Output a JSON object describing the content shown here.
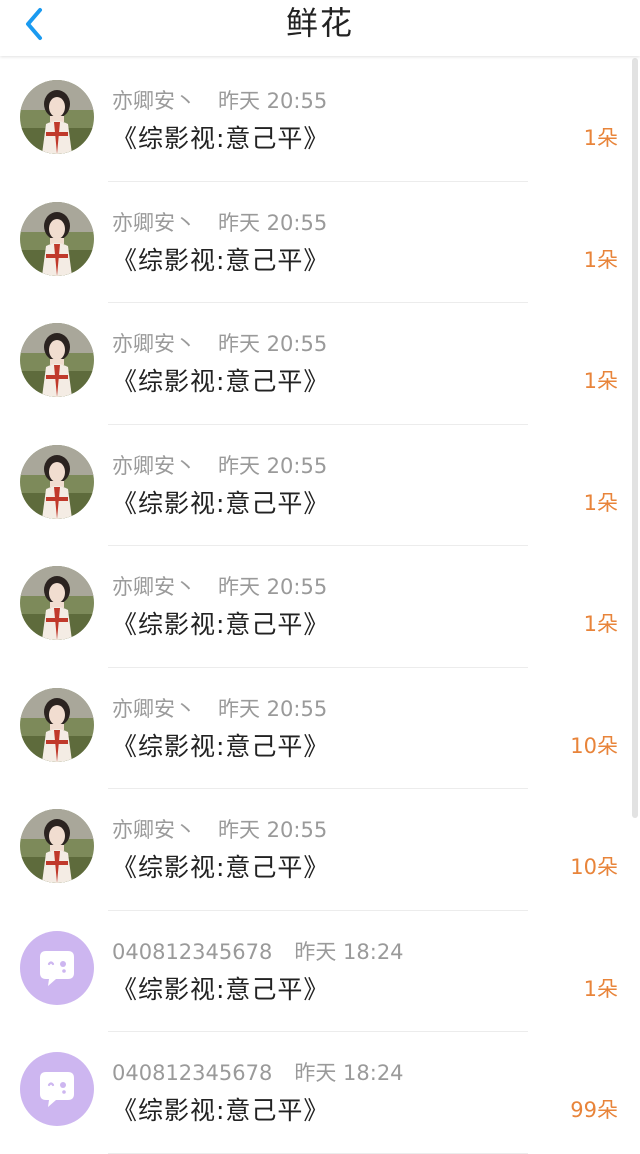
{
  "header": {
    "title": "鲜花",
    "back_icon": "chevron-left-icon",
    "accent_color": "#1a9af0"
  },
  "colors": {
    "amount": "#e8843a",
    "meta": "#9a9a9a",
    "book": "#222222",
    "default_avatar_bg": "#cdb6f0"
  },
  "rows": [
    {
      "name": "亦卿安丶",
      "time": "昨天 20:55",
      "book": "《综影视:意己平》",
      "amount": "1朵",
      "avatar": "photo"
    },
    {
      "name": "亦卿安丶",
      "time": "昨天 20:55",
      "book": "《综影视:意己平》",
      "amount": "1朵",
      "avatar": "photo"
    },
    {
      "name": "亦卿安丶",
      "time": "昨天 20:55",
      "book": "《综影视:意己平》",
      "amount": "1朵",
      "avatar": "photo"
    },
    {
      "name": "亦卿安丶",
      "time": "昨天 20:55",
      "book": "《综影视:意己平》",
      "amount": "1朵",
      "avatar": "photo"
    },
    {
      "name": "亦卿安丶",
      "time": "昨天 20:55",
      "book": "《综影视:意己平》",
      "amount": "1朵",
      "avatar": "photo"
    },
    {
      "name": "亦卿安丶",
      "time": "昨天 20:55",
      "book": "《综影视:意己平》",
      "amount": "10朵",
      "avatar": "photo"
    },
    {
      "name": "亦卿安丶",
      "time": "昨天 20:55",
      "book": "《综影视:意己平》",
      "amount": "10朵",
      "avatar": "photo"
    },
    {
      "name": "040812345678",
      "time": "昨天 18:24",
      "book": "《综影视:意己平》",
      "amount": "1朵",
      "avatar": "default-chat"
    },
    {
      "name": "040812345678",
      "time": "昨天 18:24",
      "book": "《综影视:意己平》",
      "amount": "99朵",
      "avatar": "default-chat"
    }
  ]
}
